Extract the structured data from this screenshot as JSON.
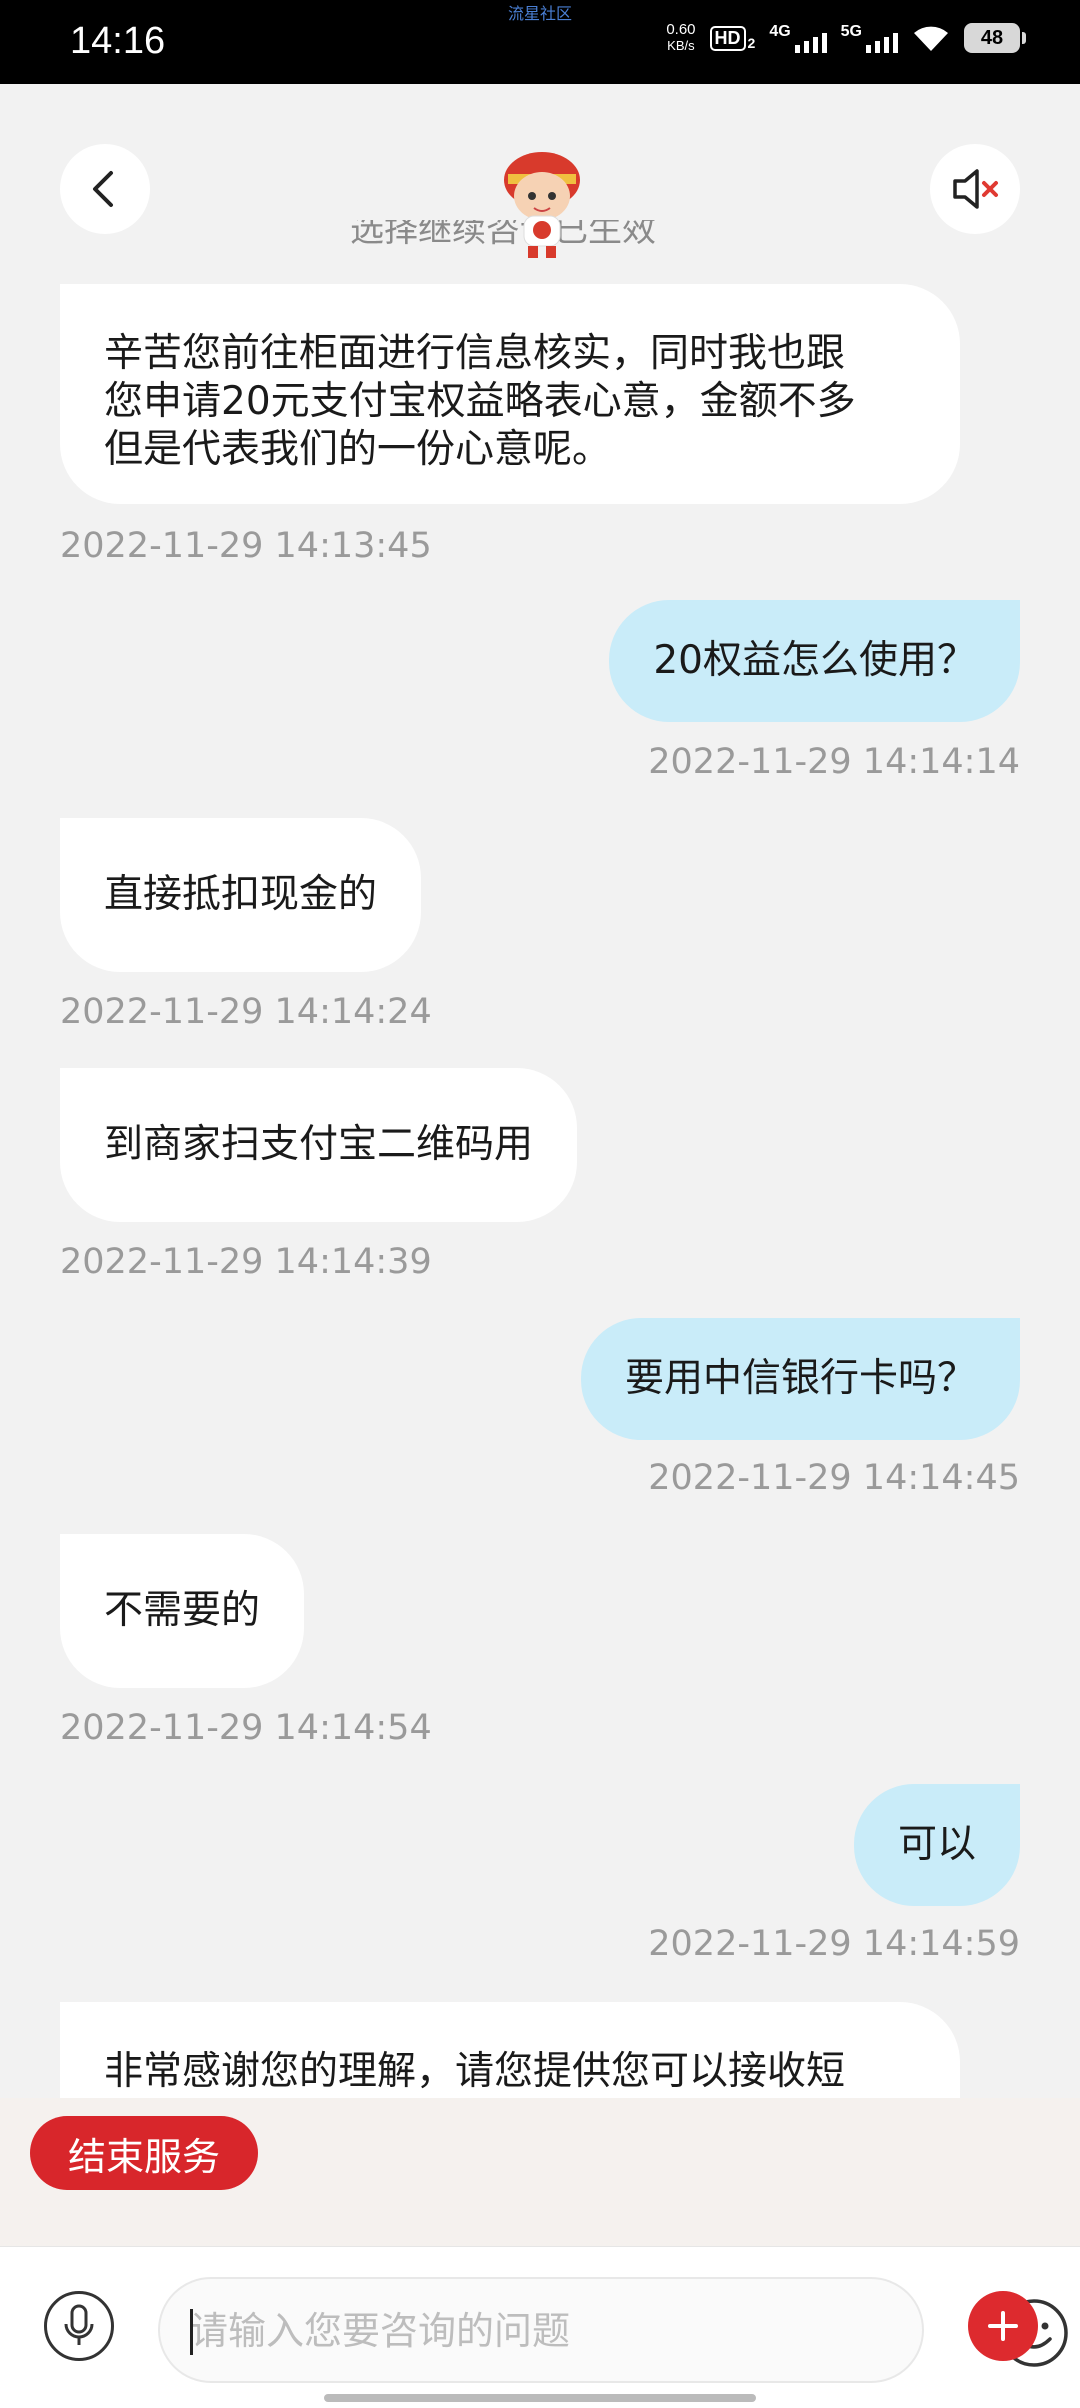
{
  "status_bar": {
    "time": "14:16",
    "watermark": "流星社区",
    "net_speed_value": "0.60",
    "net_speed_unit": "KB/s",
    "hd_badge": "HD",
    "hd_sub": "2",
    "signal_1": "4G",
    "signal_2": "5G",
    "battery": "48"
  },
  "header": {
    "back_icon": "chevron-left-icon",
    "mute_icon": "speaker-muted-icon",
    "mascot_icon": "mascot-avatar",
    "partial_notice": "选择继续咨询已生效"
  },
  "messages": [
    {
      "side": "left",
      "lines": [
        "辛苦您前往柜面进行信息核实，同时我也跟",
        "您申请20元支付宝权益略表心意，金额不多",
        "但是代表我们的一份心意呢。"
      ],
      "time": "2022-11-29 14:13:45"
    },
    {
      "side": "right",
      "text": "20权益怎么使用？",
      "time": "2022-11-29 14:14:14"
    },
    {
      "side": "left",
      "text": "直接抵扣现金的",
      "time": "2022-11-29 14:14:24"
    },
    {
      "side": "left",
      "text": "到商家扫支付宝二维码用",
      "time": "2022-11-29 14:14:39"
    },
    {
      "side": "right",
      "text": "要用中信银行卡吗？",
      "time": "2022-11-29 14:14:45"
    },
    {
      "side": "left",
      "text": "不需要的",
      "time": "2022-11-29 14:14:54"
    },
    {
      "side": "right",
      "text": "可以",
      "time": "2022-11-29 14:14:59"
    },
    {
      "side": "left",
      "lines": [
        "非常感谢您的理解，请您提供您可以接收短"
      ]
    }
  ],
  "end_service": {
    "label": "结束服务"
  },
  "input": {
    "placeholder": "请输入您要咨询的问题",
    "value": "",
    "mic_icon": "microphone-icon",
    "emoji_icon": "emoji-icon",
    "plus_icon": "plus-icon"
  },
  "colors": {
    "accent_red": "#d8262b",
    "user_bubble": "#c9ecf9",
    "agent_bubble": "#ffffff",
    "background": "#f2f2f2"
  }
}
